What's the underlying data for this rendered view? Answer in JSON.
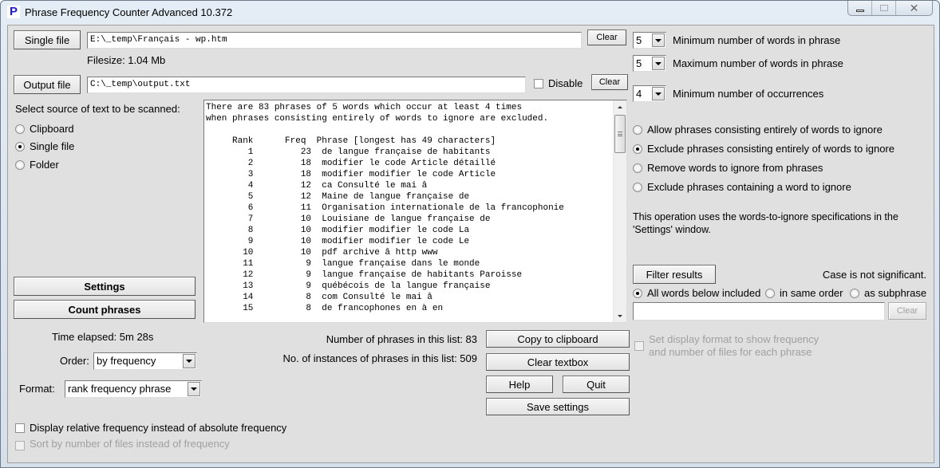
{
  "window": {
    "title": "Phrase Frequency Counter Advanced 10.372",
    "app_icon_letter": "P",
    "controls": {
      "minimize": "minimize",
      "maximize": "maximize",
      "close": "✕"
    }
  },
  "input": {
    "single_file_button": "Single file",
    "single_file_path": "E:\\_temp\\Français - wp.htm",
    "clear_label": "Clear",
    "filesize": "Filesize: 1.04 Mb",
    "output_file_button": "Output file",
    "output_file_path": "C:\\_temp\\output.txt",
    "disable_label": "Disable",
    "disable_checked": false
  },
  "source": {
    "heading": "Select source of text to be scanned:",
    "options": [
      {
        "label": "Clipboard",
        "selected": false
      },
      {
        "label": "Single file",
        "selected": true
      },
      {
        "label": "Folder",
        "selected": false
      }
    ]
  },
  "actions": {
    "settings": "Settings",
    "count_phrases": "Count phrases",
    "time_elapsed": "Time elapsed: 5m 28s",
    "order_label": "Order:",
    "order_value": "by frequency",
    "format_label": "Format:",
    "format_value": "rank frequency phrase",
    "display_relative": {
      "label": "Display relative frequency instead of absolute frequency",
      "checked": false
    },
    "sort_by_files": {
      "label": "Sort by number of files instead of frequency",
      "checked": false,
      "disabled": true
    }
  },
  "options": {
    "min_words": {
      "value": "5",
      "label": "Minimum number of words in phrase"
    },
    "max_words": {
      "value": "5",
      "label": "Maximum number of words in phrase"
    },
    "min_occurrences": {
      "value": "4",
      "label": "Minimum number of occurrences"
    },
    "ignore_modes": [
      {
        "label": "Allow phrases consisting entirely of words to ignore",
        "selected": false
      },
      {
        "label": "Exclude phrases consisting entirely of words to ignore",
        "selected": true
      },
      {
        "label": "Remove words to ignore from phrases",
        "selected": false
      },
      {
        "label": "Exclude phrases containing a word to ignore",
        "selected": false
      }
    ],
    "note": "This operation uses the words-to-ignore specifications in the 'Settings' window."
  },
  "filter": {
    "button": "Filter results",
    "case_note": "Case is not significant.",
    "modes": [
      {
        "label": "All words below included",
        "selected": true
      },
      {
        "label": "in same order",
        "selected": false
      },
      {
        "label": "as subphrase",
        "selected": false
      }
    ],
    "input_value": "",
    "clear_label": "Clear",
    "display_format": {
      "label_line1": "Set display format to show frequency",
      "label_line2": "and number of files for each phrase",
      "checked": false,
      "disabled": true
    }
  },
  "results": {
    "summary_line1": "There are 83 phrases of 5 words which occur at least 4 times",
    "summary_line2": "when phrases consisting entirely of words to ignore are excluded.",
    "columns": [
      "Rank",
      "Freq",
      "Phrase [longest has 49 characters]"
    ],
    "rows": [
      {
        "rank": 1,
        "freq": 23,
        "phrase": "de langue française de habitants"
      },
      {
        "rank": 2,
        "freq": 18,
        "phrase": "modifier le code Article détaillé"
      },
      {
        "rank": 3,
        "freq": 18,
        "phrase": "modifier modifier le code Article"
      },
      {
        "rank": 4,
        "freq": 12,
        "phrase": "ca Consulté le mai â"
      },
      {
        "rank": 5,
        "freq": 12,
        "phrase": "Maine de langue française de"
      },
      {
        "rank": 6,
        "freq": 11,
        "phrase": "Organisation internationale de la francophonie"
      },
      {
        "rank": 7,
        "freq": 10,
        "phrase": "Louisiane de langue française de"
      },
      {
        "rank": 8,
        "freq": 10,
        "phrase": "modifier modifier le code La"
      },
      {
        "rank": 9,
        "freq": 10,
        "phrase": "modifier modifier le code Le"
      },
      {
        "rank": 10,
        "freq": 10,
        "phrase": "pdf archive â http www"
      },
      {
        "rank": 11,
        "freq": 9,
        "phrase": "langue française dans le monde"
      },
      {
        "rank": 12,
        "freq": 9,
        "phrase": "langue française de habitants Paroisse"
      },
      {
        "rank": 13,
        "freq": 9,
        "phrase": "québécois de la langue française"
      },
      {
        "rank": 14,
        "freq": 8,
        "phrase": "com Consulté le mai â"
      },
      {
        "rank": 15,
        "freq": 8,
        "phrase": "de francophones en à en"
      }
    ],
    "count_phrases": "Number of phrases in this list: 83",
    "count_instances": "No. of instances of phrases in this list: 509"
  },
  "bottom_buttons": {
    "copy": "Copy to clipboard",
    "clear_textbox": "Clear textbox",
    "help": "Help",
    "quit": "Quit",
    "save_settings": "Save settings"
  }
}
